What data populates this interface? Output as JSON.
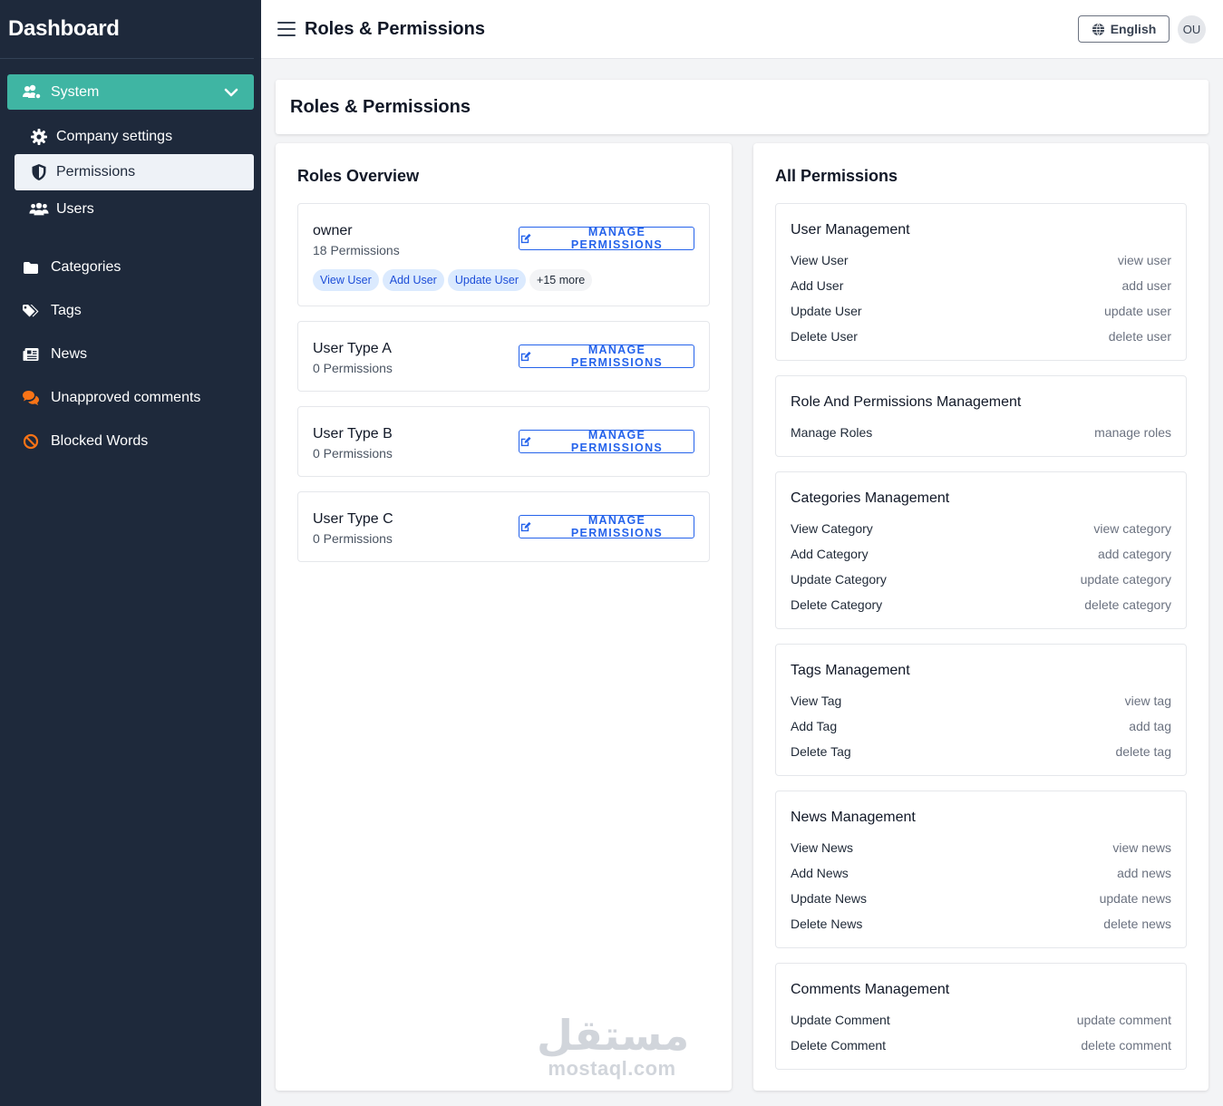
{
  "sidebar": {
    "brand": "Dashboard",
    "group": {
      "label": "System",
      "icon": "users-cog-icon"
    },
    "subitems": [
      {
        "label": "Company settings",
        "icon": "gear-icon",
        "active": false
      },
      {
        "label": "Permissions",
        "icon": "shield-icon",
        "active": true
      },
      {
        "label": "Users",
        "icon": "users-icon",
        "active": false
      }
    ],
    "items": [
      {
        "label": "Categories",
        "icon": "folder-icon"
      },
      {
        "label": "Tags",
        "icon": "tags-icon"
      },
      {
        "label": "News",
        "icon": "newspaper-icon"
      },
      {
        "label": "Unapproved comments",
        "icon": "comments-icon",
        "color": "#f97316"
      },
      {
        "label": "Blocked Words",
        "icon": "ban-icon",
        "color": "#f97316"
      }
    ]
  },
  "topbar": {
    "title": "Roles & Permissions",
    "language": "English",
    "avatar": "OU"
  },
  "page": {
    "title": "Roles & Permissions"
  },
  "roles": {
    "heading": "Roles Overview",
    "manage_label": "MANAGE PERMISSIONS",
    "items": [
      {
        "name": "owner",
        "count": "18 Permissions",
        "chips": [
          "View User",
          "Add User",
          "Update User"
        ],
        "more": "+15 more"
      },
      {
        "name": "User Type A",
        "count": "0 Permissions"
      },
      {
        "name": "User Type B",
        "count": "0 Permissions"
      },
      {
        "name": "User Type C",
        "count": "0 Permissions"
      }
    ]
  },
  "permissions": {
    "heading": "All Permissions",
    "groups": [
      {
        "title": "User Management",
        "rows": [
          {
            "name": "View User",
            "key": "view user"
          },
          {
            "name": "Add User",
            "key": "add user"
          },
          {
            "name": "Update User",
            "key": "update user"
          },
          {
            "name": "Delete User",
            "key": "delete user"
          }
        ]
      },
      {
        "title": "Role And Permissions Management",
        "rows": [
          {
            "name": "Manage Roles",
            "key": "manage roles"
          }
        ]
      },
      {
        "title": "Categories Management",
        "rows": [
          {
            "name": "View Category",
            "key": "view category"
          },
          {
            "name": "Add Category",
            "key": "add category"
          },
          {
            "name": "Update Category",
            "key": "update category"
          },
          {
            "name": "Delete Category",
            "key": "delete category"
          }
        ]
      },
      {
        "title": "Tags Management",
        "rows": [
          {
            "name": "View Tag",
            "key": "view tag"
          },
          {
            "name": "Add Tag",
            "key": "add tag"
          },
          {
            "name": "Delete Tag",
            "key": "delete tag"
          }
        ]
      },
      {
        "title": "News Management",
        "rows": [
          {
            "name": "View News",
            "key": "view news"
          },
          {
            "name": "Add News",
            "key": "add news"
          },
          {
            "name": "Update News",
            "key": "update news"
          },
          {
            "name": "Delete News",
            "key": "delete news"
          }
        ]
      },
      {
        "title": "Comments Management",
        "rows": [
          {
            "name": "Update Comment",
            "key": "update comment"
          },
          {
            "name": "Delete Comment",
            "key": "delete comment"
          }
        ]
      }
    ]
  },
  "watermark": {
    "arabic": "مستقل",
    "latin": "mostaql.com"
  },
  "colors": {
    "sidebar": "#1e293b",
    "accent": "#3fb5a3",
    "link": "#2563eb",
    "warning": "#f97316"
  }
}
